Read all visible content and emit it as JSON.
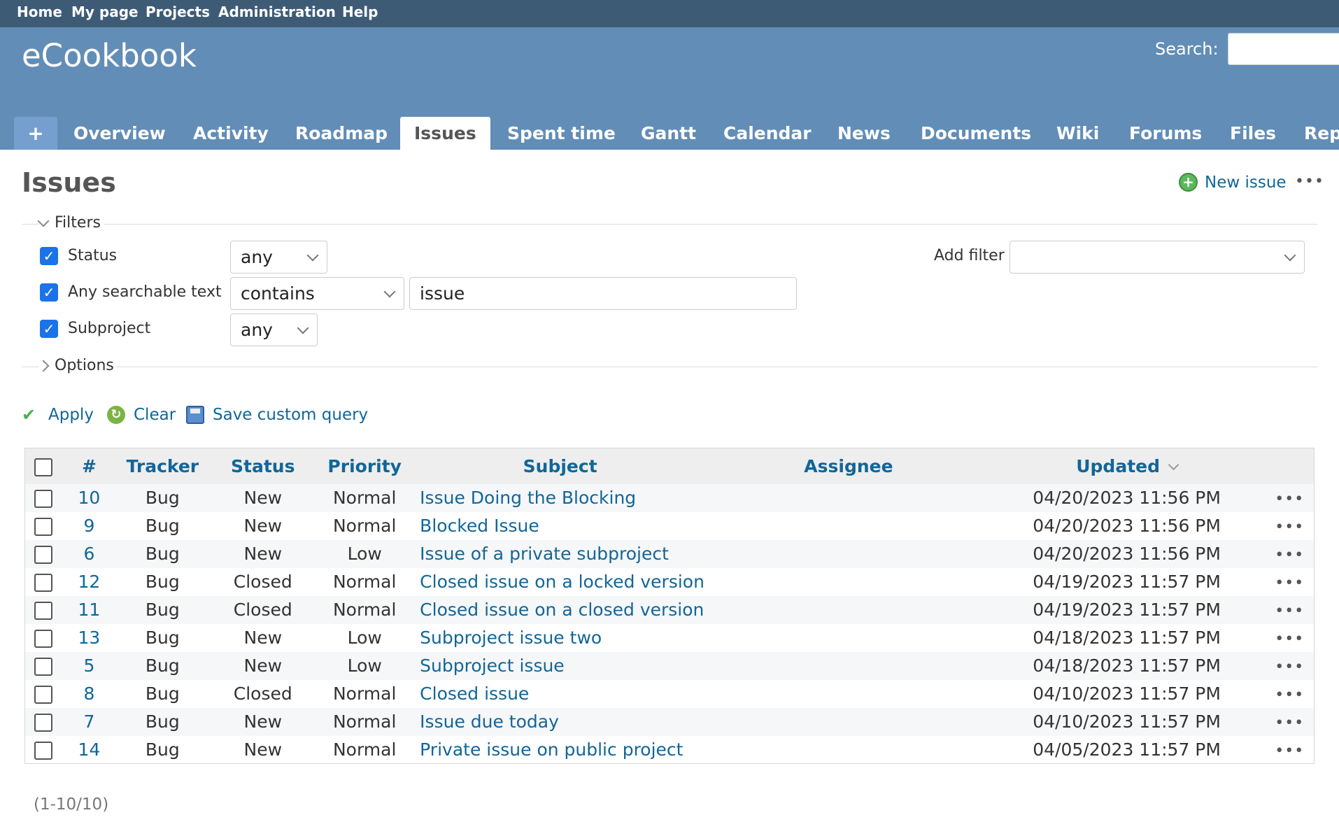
{
  "top_menu": [
    "Home",
    "My page",
    "Projects",
    "Administration",
    "Help"
  ],
  "header": {
    "project_title": "eCookbook",
    "search_label": "Search:",
    "search_value": ""
  },
  "tabs": {
    "plus": "+",
    "items": [
      "Overview",
      "Activity",
      "Roadmap",
      "Issues",
      "Spent time",
      "Gantt",
      "Calendar",
      "News",
      "Documents",
      "Wiki",
      "Forums",
      "Files",
      "Rep"
    ],
    "selected": "Issues"
  },
  "page": {
    "title": "Issues",
    "new_issue": "New issue",
    "more": "•••"
  },
  "filters": {
    "legend": "Filters",
    "add_filter_label": "Add filter",
    "add_filter_value": "",
    "rows": [
      {
        "label": "Status",
        "checked": true,
        "operator": "any",
        "value": ""
      },
      {
        "label": "Any searchable text",
        "checked": true,
        "operator": "contains",
        "value": "issue"
      },
      {
        "label": "Subproject",
        "checked": true,
        "operator": "any",
        "value": ""
      }
    ]
  },
  "options": {
    "legend": "Options"
  },
  "actions": {
    "apply": "Apply",
    "clear": "Clear",
    "save": "Save custom query"
  },
  "table": {
    "columns": [
      "#",
      "Tracker",
      "Status",
      "Priority",
      "Subject",
      "Assignee",
      "Updated"
    ],
    "sort_column": "Updated",
    "rows": [
      {
        "id": "10",
        "tracker": "Bug",
        "status": "New",
        "priority": "Normal",
        "subject": "Issue Doing the Blocking",
        "assignee": "",
        "updated": "04/20/2023 11:56 PM"
      },
      {
        "id": "9",
        "tracker": "Bug",
        "status": "New",
        "priority": "Normal",
        "subject": "Blocked Issue",
        "assignee": "",
        "updated": "04/20/2023 11:56 PM"
      },
      {
        "id": "6",
        "tracker": "Bug",
        "status": "New",
        "priority": "Low",
        "subject": "Issue of a private subproject",
        "assignee": "",
        "updated": "04/20/2023 11:56 PM"
      },
      {
        "id": "12",
        "tracker": "Bug",
        "status": "Closed",
        "priority": "Normal",
        "subject": "Closed issue on a locked version",
        "assignee": "",
        "updated": "04/19/2023 11:57 PM"
      },
      {
        "id": "11",
        "tracker": "Bug",
        "status": "Closed",
        "priority": "Normal",
        "subject": "Closed issue on a closed version",
        "assignee": "",
        "updated": "04/19/2023 11:57 PM"
      },
      {
        "id": "13",
        "tracker": "Bug",
        "status": "New",
        "priority": "Low",
        "subject": "Subproject issue two",
        "assignee": "",
        "updated": "04/18/2023 11:57 PM"
      },
      {
        "id": "5",
        "tracker": "Bug",
        "status": "New",
        "priority": "Low",
        "subject": "Subproject issue",
        "assignee": "",
        "updated": "04/18/2023 11:57 PM"
      },
      {
        "id": "8",
        "tracker": "Bug",
        "status": "Closed",
        "priority": "Normal",
        "subject": "Closed issue",
        "assignee": "",
        "updated": "04/10/2023 11:57 PM"
      },
      {
        "id": "7",
        "tracker": "Bug",
        "status": "New",
        "priority": "Normal",
        "subject": "Issue due today",
        "assignee": "",
        "updated": "04/10/2023 11:57 PM"
      },
      {
        "id": "14",
        "tracker": "Bug",
        "status": "New",
        "priority": "Normal",
        "subject": "Private issue on public project",
        "assignee": "",
        "updated": "04/05/2023 11:57 PM"
      }
    ],
    "row_menu": "•••"
  },
  "pagination": "(1-10/10)",
  "colors": {
    "top_menu_bg": "#3e5b76",
    "header_bg": "#628db6",
    "link": "#116699",
    "checkbox_checked": "#1a73e8"
  }
}
